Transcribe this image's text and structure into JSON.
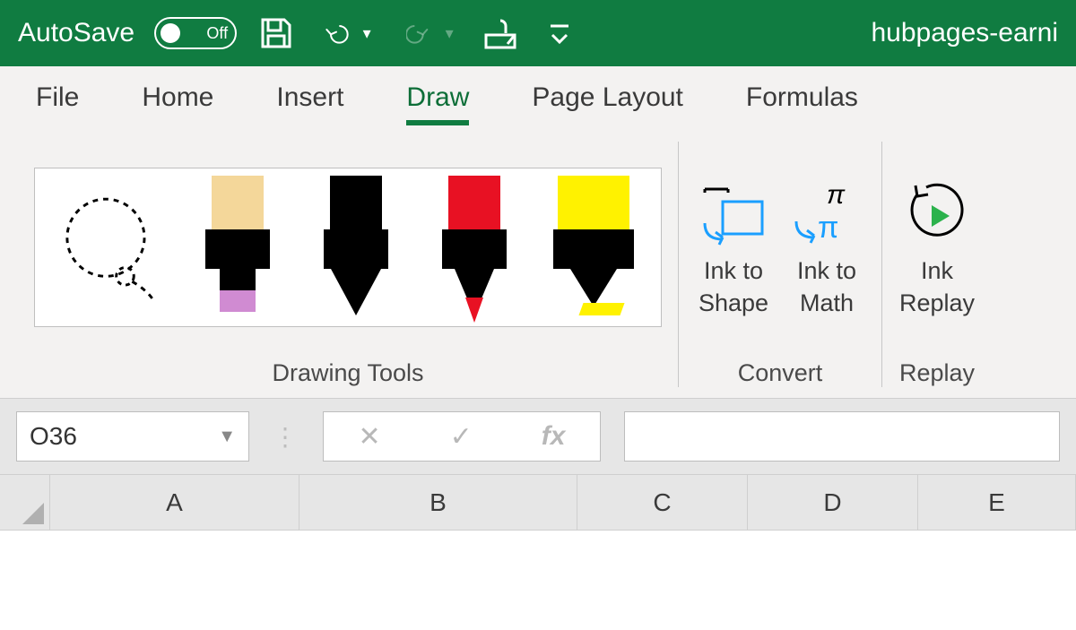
{
  "titlebar": {
    "autosave_label": "AutoSave",
    "autosave_state": "Off",
    "document_name": "hubpages-earni"
  },
  "tabs": {
    "file": "File",
    "home": "Home",
    "insert": "Insert",
    "draw": "Draw",
    "page_layout": "Page Layout",
    "formulas": "Formulas",
    "active": "draw"
  },
  "ribbon": {
    "drawing_tools_label": "Drawing Tools",
    "convert": {
      "label": "Convert",
      "ink_shape_l1": "Ink to",
      "ink_shape_l2": "Shape",
      "ink_math_l1": "Ink to",
      "ink_math_l2": "Math"
    },
    "replay": {
      "label": "Replay",
      "ink_replay_l1": "Ink",
      "ink_replay_l2": "Replay"
    }
  },
  "formula_bar": {
    "cell_ref": "O36",
    "fx_symbol": "fx"
  },
  "columns": {
    "A": "A",
    "B": "B",
    "C": "C",
    "D": "D",
    "E": "E"
  }
}
